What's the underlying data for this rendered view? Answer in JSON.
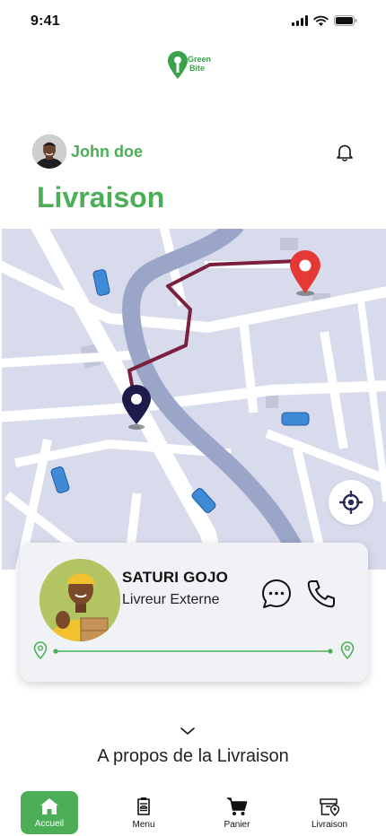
{
  "status": {
    "time": "9:41"
  },
  "logo": {
    "line1": "Green",
    "line2": "Bite"
  },
  "user": {
    "name": "John doe"
  },
  "page": {
    "title": "Livraison"
  },
  "driver": {
    "name": "SATURI GOJO",
    "role": "Livreur Externe"
  },
  "about": {
    "label": "A propos de la Livraison"
  },
  "nav": [
    {
      "label": "Accueil",
      "icon": "home-icon",
      "active": true
    },
    {
      "label": "Menu",
      "icon": "menu-icon",
      "active": false
    },
    {
      "label": "Panier",
      "icon": "cart-icon",
      "active": false
    },
    {
      "label": "Livraison",
      "icon": "delivery-icon",
      "active": false
    }
  ],
  "colors": {
    "brand": "#4caf58",
    "route": "#7a1f3d",
    "destination": "#e53935",
    "origin": "#1d1b4a",
    "map_bg": "#d8dbec",
    "road": "#ffffff",
    "highway": "#9ba5c7"
  }
}
